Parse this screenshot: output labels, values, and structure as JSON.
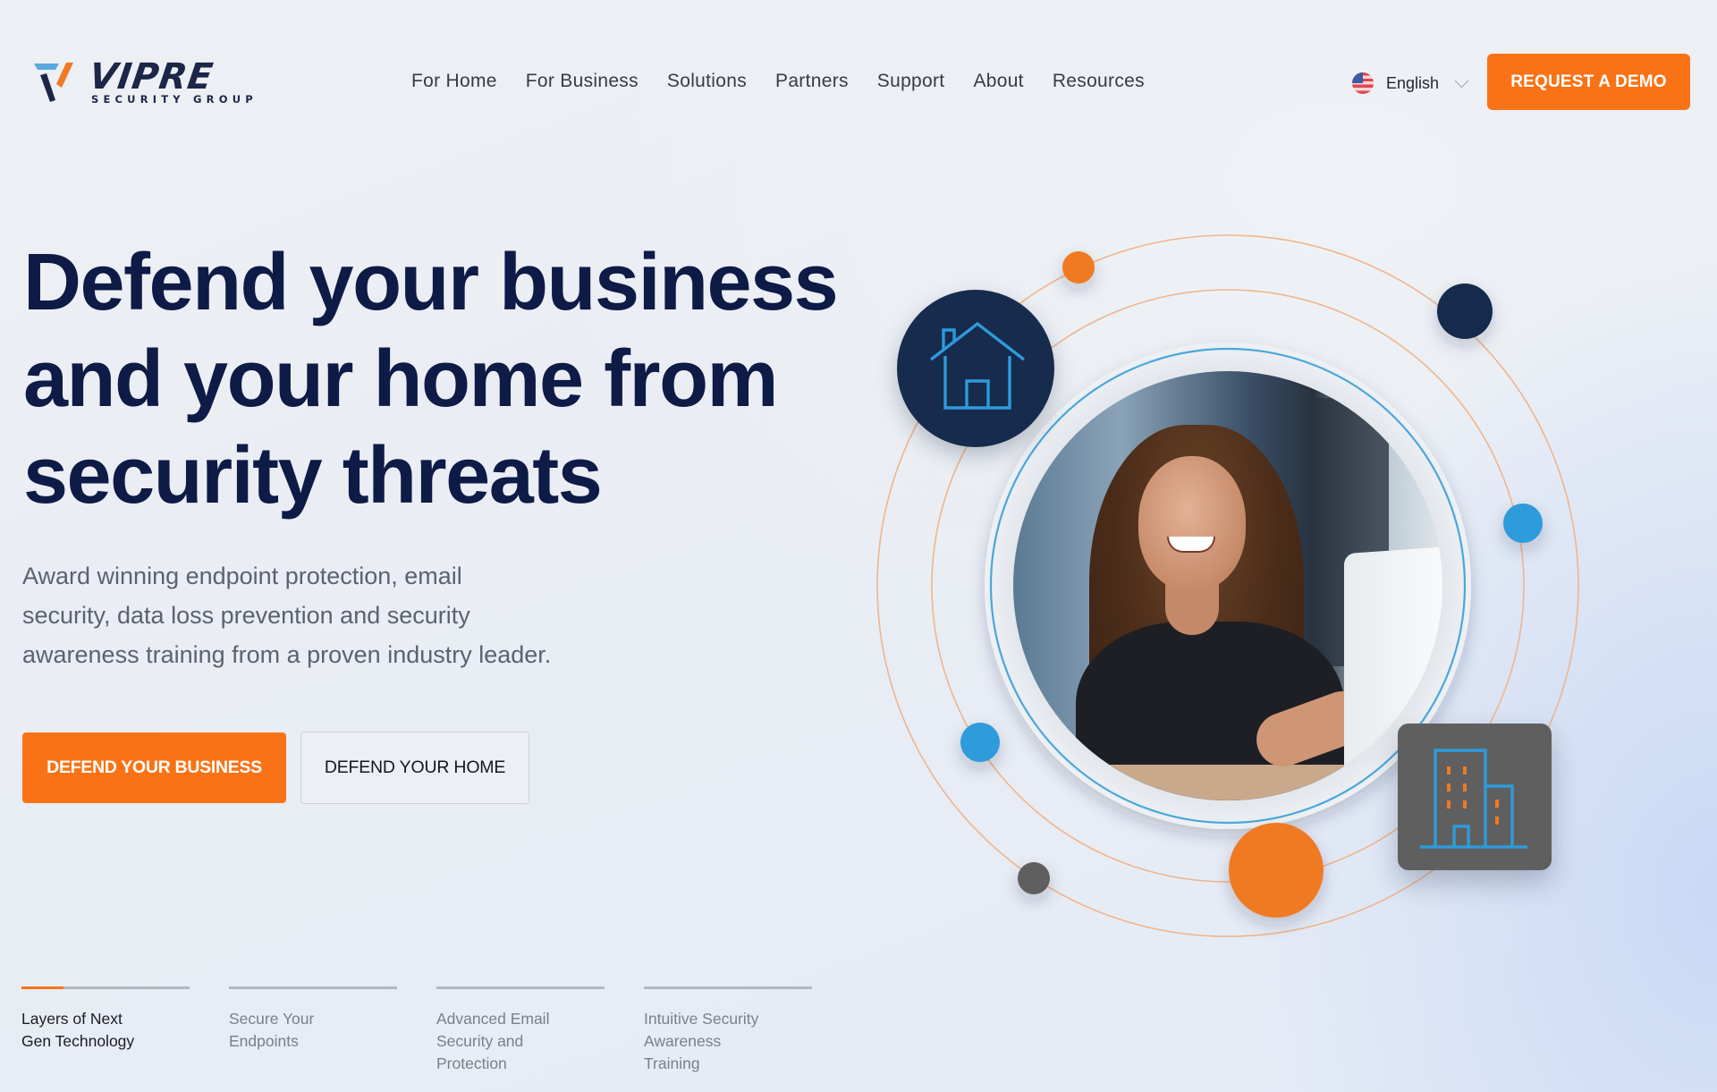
{
  "brand": {
    "name": "VIPRE",
    "tagline": "SECURITY GROUP",
    "colors": {
      "primary_orange": "#f97316",
      "navy": "#0d1b46",
      "blue": "#2d9bdb",
      "gray": "#5f5f60"
    }
  },
  "nav": {
    "items": [
      {
        "label": "For Home"
      },
      {
        "label": "For Business"
      },
      {
        "label": "Solutions"
      },
      {
        "label": "Partners"
      },
      {
        "label": "Support"
      },
      {
        "label": "About"
      },
      {
        "label": "Resources"
      }
    ],
    "language": {
      "label": "English",
      "flag_icon": "us-flag-icon"
    },
    "cta_label": "REQUEST A DEMO"
  },
  "hero": {
    "headline_lines": [
      "Defend your business",
      "and your home from",
      "security threats"
    ],
    "subtext_lines": [
      "Award winning endpoint protection, email",
      "security, data loss prevention and security",
      "awareness training from a proven industry leader."
    ],
    "primary_button": "DEFEND YOUR BUSINESS",
    "secondary_button": "DEFEND YOUR HOME"
  },
  "illustration": {
    "photo_alt": "Smiling woman working on a laptop",
    "home_icon": "house-icon",
    "business_icon": "office-building-icon"
  },
  "feature_tabs": [
    {
      "lines": [
        "Layers of Next",
        "Gen Technology"
      ],
      "active": true,
      "progress": 0.25
    },
    {
      "lines": [
        "Secure Your",
        "Endpoints"
      ],
      "active": false,
      "progress": 0
    },
    {
      "lines": [
        "Advanced Email",
        "Security and",
        "Protection"
      ],
      "active": false,
      "progress": 0
    },
    {
      "lines": [
        "Intuitive Security",
        "Awareness",
        "Training"
      ],
      "active": false,
      "progress": 0
    }
  ]
}
